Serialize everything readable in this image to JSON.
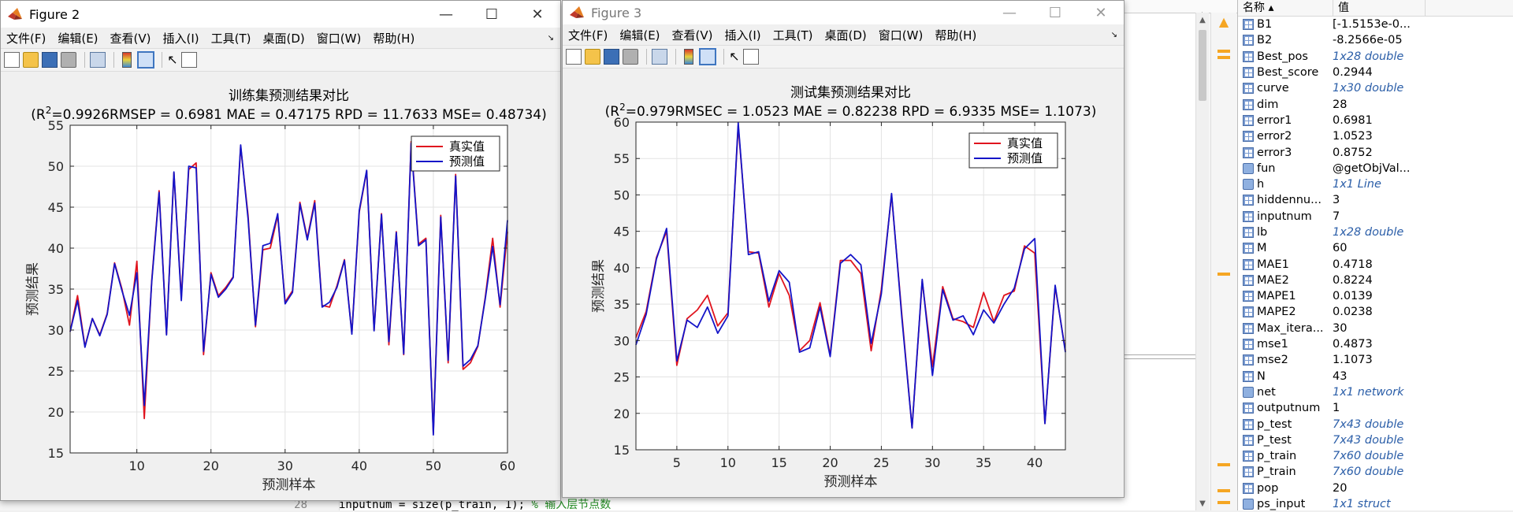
{
  "editor": {
    "line_number": "28",
    "code": "inputnum  = size(p_train, 1);",
    "comment": "% 输入层节点数"
  },
  "workspace": {
    "header": {
      "name": "名称 ▴",
      "value": "值"
    },
    "rows": [
      {
        "icon": "grid",
        "name": "B1",
        "value": "[-1.5153e-0...",
        "link": false
      },
      {
        "icon": "grid",
        "name": "B2",
        "value": "-8.2566e-05",
        "link": false
      },
      {
        "icon": "grid",
        "name": "Best_pos",
        "value": "1x28 double",
        "link": true
      },
      {
        "icon": "grid",
        "name": "Best_score",
        "value": "0.2944",
        "link": false
      },
      {
        "icon": "grid",
        "name": "curve",
        "value": "1x30 double",
        "link": true
      },
      {
        "icon": "grid",
        "name": "dim",
        "value": "28",
        "link": false
      },
      {
        "icon": "grid",
        "name": "error1",
        "value": "0.6981",
        "link": false
      },
      {
        "icon": "grid",
        "name": "error2",
        "value": "1.0523",
        "link": false
      },
      {
        "icon": "grid",
        "name": "error3",
        "value": "0.8752",
        "link": false
      },
      {
        "icon": "obj",
        "name": "fun",
        "value": "@getObjVal...",
        "link": false
      },
      {
        "icon": "obj",
        "name": "h",
        "value": "1x1 Line",
        "link": true
      },
      {
        "icon": "grid",
        "name": "hiddennu...",
        "value": "3",
        "link": false
      },
      {
        "icon": "grid",
        "name": "inputnum",
        "value": "7",
        "link": false
      },
      {
        "icon": "grid",
        "name": "lb",
        "value": "1x28 double",
        "link": true
      },
      {
        "icon": "grid",
        "name": "M",
        "value": "60",
        "link": false
      },
      {
        "icon": "grid",
        "name": "MAE1",
        "value": "0.4718",
        "link": false
      },
      {
        "icon": "grid",
        "name": "MAE2",
        "value": "0.8224",
        "link": false
      },
      {
        "icon": "grid",
        "name": "MAPE1",
        "value": "0.0139",
        "link": false
      },
      {
        "icon": "grid",
        "name": "MAPE2",
        "value": "0.0238",
        "link": false
      },
      {
        "icon": "grid",
        "name": "Max_itera...",
        "value": "30",
        "link": false
      },
      {
        "icon": "grid",
        "name": "mse1",
        "value": "0.4873",
        "link": false
      },
      {
        "icon": "grid",
        "name": "mse2",
        "value": "1.1073",
        "link": false
      },
      {
        "icon": "grid",
        "name": "N",
        "value": "43",
        "link": false
      },
      {
        "icon": "obj",
        "name": "net",
        "value": "1x1 network",
        "link": true
      },
      {
        "icon": "grid",
        "name": "outputnum",
        "value": "1",
        "link": false
      },
      {
        "icon": "grid",
        "name": "p_test",
        "value": "7x43 double",
        "link": true
      },
      {
        "icon": "grid",
        "name": "P_test",
        "value": "7x43 double",
        "link": true
      },
      {
        "icon": "grid",
        "name": "p_train",
        "value": "7x60 double",
        "link": true
      },
      {
        "icon": "grid",
        "name": "P_train",
        "value": "7x60 double",
        "link": true
      },
      {
        "icon": "grid",
        "name": "pop",
        "value": "20",
        "link": false
      },
      {
        "icon": "obj",
        "name": "ps_input",
        "value": "1x1 struct",
        "link": true
      }
    ]
  },
  "menu_items": [
    "文件(F)",
    "编辑(E)",
    "查看(V)",
    "插入(I)",
    "工具(T)",
    "桌面(D)",
    "窗口(W)",
    "帮助(H)"
  ],
  "window_controls": {
    "minimize": "—",
    "maximize": "☐",
    "close": "✕"
  },
  "figures": [
    {
      "title": "Figure 2",
      "chart_data": {
        "type": "line",
        "title": "训练集预测结果对比",
        "subtitle_prefix": "(R",
        "subtitle_sup": "2",
        "subtitle_rest": "=0.9926RMSEP = 0.6981 MAE = 0.47175 RPD = 11.7633 MSE= 0.48734)",
        "xlabel": "预测样本",
        "ylabel": "预测结果",
        "xlim": [
          1,
          60
        ],
        "ylim": [
          15,
          55
        ],
        "xticks": [
          10,
          20,
          30,
          40,
          50,
          60
        ],
        "yticks": [
          15,
          20,
          25,
          30,
          35,
          40,
          45,
          50,
          55
        ],
        "grid": true,
        "legend_position": "top-right",
        "colors": {
          "真实值": "#e0141e",
          "预测值": "#1414c8"
        },
        "x": [
          1,
          2,
          3,
          4,
          5,
          6,
          7,
          8,
          9,
          10,
          11,
          12,
          13,
          14,
          15,
          16,
          17,
          18,
          19,
          20,
          21,
          22,
          23,
          24,
          25,
          26,
          27,
          28,
          29,
          30,
          31,
          32,
          33,
          34,
          35,
          36,
          37,
          38,
          39,
          40,
          41,
          42,
          43,
          44,
          45,
          46,
          47,
          48,
          49,
          50,
          51,
          52,
          53,
          54,
          55,
          56,
          57,
          58,
          59,
          60
        ],
        "series": [
          {
            "name": "真实值",
            "values": [
              29.8,
              34.2,
              28.0,
              31.4,
              29.4,
              32.0,
              38.2,
              35.0,
              30.6,
              38.4,
              19.2,
              36.0,
              47.0,
              29.5,
              49.2,
              34.0,
              49.6,
              50.4,
              27.0,
              37.0,
              34.2,
              35.2,
              36.5,
              52.4,
              44.0,
              30.4,
              39.8,
              40.0,
              44.0,
              33.4,
              34.8,
              45.6,
              41.2,
              45.8,
              33.0,
              32.8,
              35.4,
              38.6,
              29.6,
              44.4,
              49.4,
              30.0,
              44.2,
              28.2,
              42.0,
              27.0,
              53.0,
              40.5,
              41.2,
              17.4,
              44.0,
              26.0,
              49.0,
              25.2,
              26.0,
              28.0,
              34.0,
              41.2,
              32.8,
              42.0
            ]
          },
          {
            "name": "预测值",
            "values": [
              29.8,
              33.6,
              27.9,
              31.4,
              29.3,
              31.9,
              38.1,
              34.8,
              31.8,
              37.0,
              20.8,
              35.8,
              46.8,
              29.4,
              49.3,
              33.6,
              50.0,
              49.8,
              27.4,
              36.8,
              34.0,
              35.0,
              36.4,
              52.6,
              43.6,
              30.6,
              40.3,
              40.6,
              44.2,
              33.2,
              34.6,
              45.4,
              41.0,
              45.5,
              32.8,
              33.4,
              35.2,
              38.5,
              29.5,
              44.6,
              49.5,
              29.9,
              44.1,
              28.6,
              41.9,
              27.1,
              52.8,
              40.3,
              41.0,
              17.2,
              43.8,
              26.3,
              48.8,
              25.6,
              26.4,
              28.1,
              33.8,
              40.2,
              33.1,
              43.4
            ]
          }
        ]
      }
    },
    {
      "title": "Figure 3",
      "chart_data": {
        "type": "line",
        "title": "测试集预测结果对比",
        "subtitle_prefix": "(R",
        "subtitle_sup": "2",
        "subtitle_rest": "=0.979RMSEC = 1.0523 MAE = 0.82238 RPD = 6.9335 MSE= 1.1073)",
        "xlabel": "预测样本",
        "ylabel": "预测结果",
        "xlim": [
          1,
          43
        ],
        "ylim": [
          15,
          60
        ],
        "xticks": [
          5,
          10,
          15,
          20,
          25,
          30,
          35,
          40
        ],
        "yticks": [
          15,
          20,
          25,
          30,
          35,
          40,
          45,
          50,
          55,
          60
        ],
        "grid": true,
        "legend_position": "top-right",
        "colors": {
          "真实值": "#e0141e",
          "预测值": "#1414c8"
        },
        "x": [
          1,
          2,
          3,
          4,
          5,
          6,
          7,
          8,
          9,
          10,
          11,
          12,
          13,
          14,
          15,
          16,
          17,
          18,
          19,
          20,
          21,
          22,
          23,
          24,
          25,
          26,
          27,
          28,
          29,
          30,
          31,
          32,
          33,
          34,
          35,
          36,
          37,
          38,
          39,
          40,
          41,
          42,
          43
        ],
        "series": [
          {
            "name": "真实值",
            "values": [
              30.4,
              34.0,
              41.4,
              45.0,
              26.6,
              33.0,
              34.2,
              36.2,
              32.0,
              33.8,
              59.5,
              42.2,
              42.0,
              34.6,
              39.2,
              36.2,
              28.6,
              30.0,
              35.2,
              28.0,
              41.0,
              41.0,
              39.2,
              28.6,
              37.0,
              50.0,
              33.6,
              18.0,
              38.2,
              26.4,
              37.4,
              33.0,
              32.6,
              31.8,
              36.6,
              32.6,
              36.2,
              36.8,
              43.0,
              42.0,
              18.6,
              37.4,
              28.6
            ]
          },
          {
            "name": "预测值",
            "values": [
              29.4,
              33.6,
              41.2,
              45.4,
              27.2,
              32.8,
              31.8,
              34.6,
              31.0,
              33.4,
              59.9,
              41.8,
              42.2,
              35.4,
              39.6,
              38.0,
              28.4,
              29.0,
              34.6,
              27.8,
              40.6,
              41.8,
              40.4,
              29.6,
              36.4,
              50.2,
              33.2,
              18.0,
              38.4,
              25.2,
              37.0,
              32.8,
              33.4,
              30.8,
              34.2,
              32.4,
              35.0,
              37.2,
              42.6,
              44.0,
              18.6,
              37.6,
              28.4
            ]
          }
        ]
      }
    }
  ]
}
